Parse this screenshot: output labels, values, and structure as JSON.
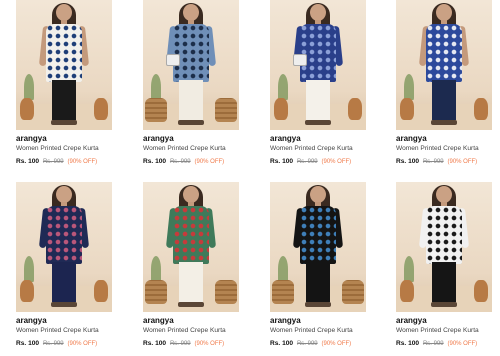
{
  "products": [
    {
      "brand": "arangya",
      "title": "Women Printed Crepe Kurta",
      "price": "Rs. 100",
      "mrp": "Rs. 999",
      "discount": "(90% OFF)",
      "kurta_color": "#f3f1ec",
      "pattern": "#1f3f78",
      "pants_color": "#1a1a1a",
      "arm_color": "#c49a7c",
      "decor": "pot",
      "bag": false
    },
    {
      "brand": "arangya",
      "title": "Women Printed Crepe Kurta",
      "price": "Rs. 100",
      "mrp": "Rs. 999",
      "discount": "(90% OFF)",
      "kurta_color": "#6f8fb8",
      "pattern": "#1c2e4a",
      "pants_color": "#f1ece2",
      "arm_color": "#6f8fb8",
      "decor": "basket",
      "bag": true
    },
    {
      "brand": "arangya",
      "title": "Women Printed Crepe Kurta",
      "price": "Rs. 100",
      "mrp": "Rs. 999",
      "discount": "(90% OFF)",
      "kurta_color": "#2a3f8a",
      "pattern": "#8ca0d8",
      "pants_color": "#f4f1ea",
      "arm_color": "#2a3f8a",
      "decor": "pot",
      "bag": true
    },
    {
      "brand": "arangya",
      "title": "Women Printed Crepe Kurta",
      "price": "Rs. 100",
      "mrp": "Rs. 999",
      "discount": "(90% OFF)",
      "kurta_color": "#2d4a9c",
      "pattern": "#e6e9f2",
      "pants_color": "#1c2a4f",
      "arm_color": "#c49a7c",
      "decor": "pot",
      "bag": false
    },
    {
      "brand": "arangya",
      "title": "Women Printed Crepe Kurta",
      "price": "Rs. 100",
      "mrp": "Rs. 999",
      "discount": "(90% OFF)",
      "kurta_color": "#1f2a55",
      "pattern": "#b9577a",
      "pants_color": "#1c2550",
      "arm_color": "#1f2a55",
      "decor": "pot",
      "bag": false
    },
    {
      "brand": "arangya",
      "title": "Women Printed Crepe Kurta",
      "price": "Rs. 100",
      "mrp": "Rs. 999",
      "discount": "(90% OFF)",
      "kurta_color": "#3f7a5a",
      "pattern": "#c63b3b",
      "pants_color": "#f3efe6",
      "arm_color": "#3f7a5a",
      "decor": "basket",
      "bag": false
    },
    {
      "brand": "arangya",
      "title": "Women Printed Crepe Kurta",
      "price": "Rs. 100",
      "mrp": "Rs. 999",
      "discount": "(90% OFF)",
      "kurta_color": "#141414",
      "pattern": "#3f7fb8",
      "pants_color": "#141414",
      "arm_color": "#141414",
      "decor": "basket",
      "bag": false
    },
    {
      "brand": "arangya",
      "title": "Women Printed Crepe Kurta",
      "price": "Rs. 100",
      "mrp": "Rs. 999",
      "discount": "(90% OFF)",
      "kurta_color": "#f1f1f1",
      "pattern": "#1a1a1a",
      "pants_color": "#151515",
      "arm_color": "#f1f1f1",
      "decor": "pot",
      "bag": false
    }
  ]
}
